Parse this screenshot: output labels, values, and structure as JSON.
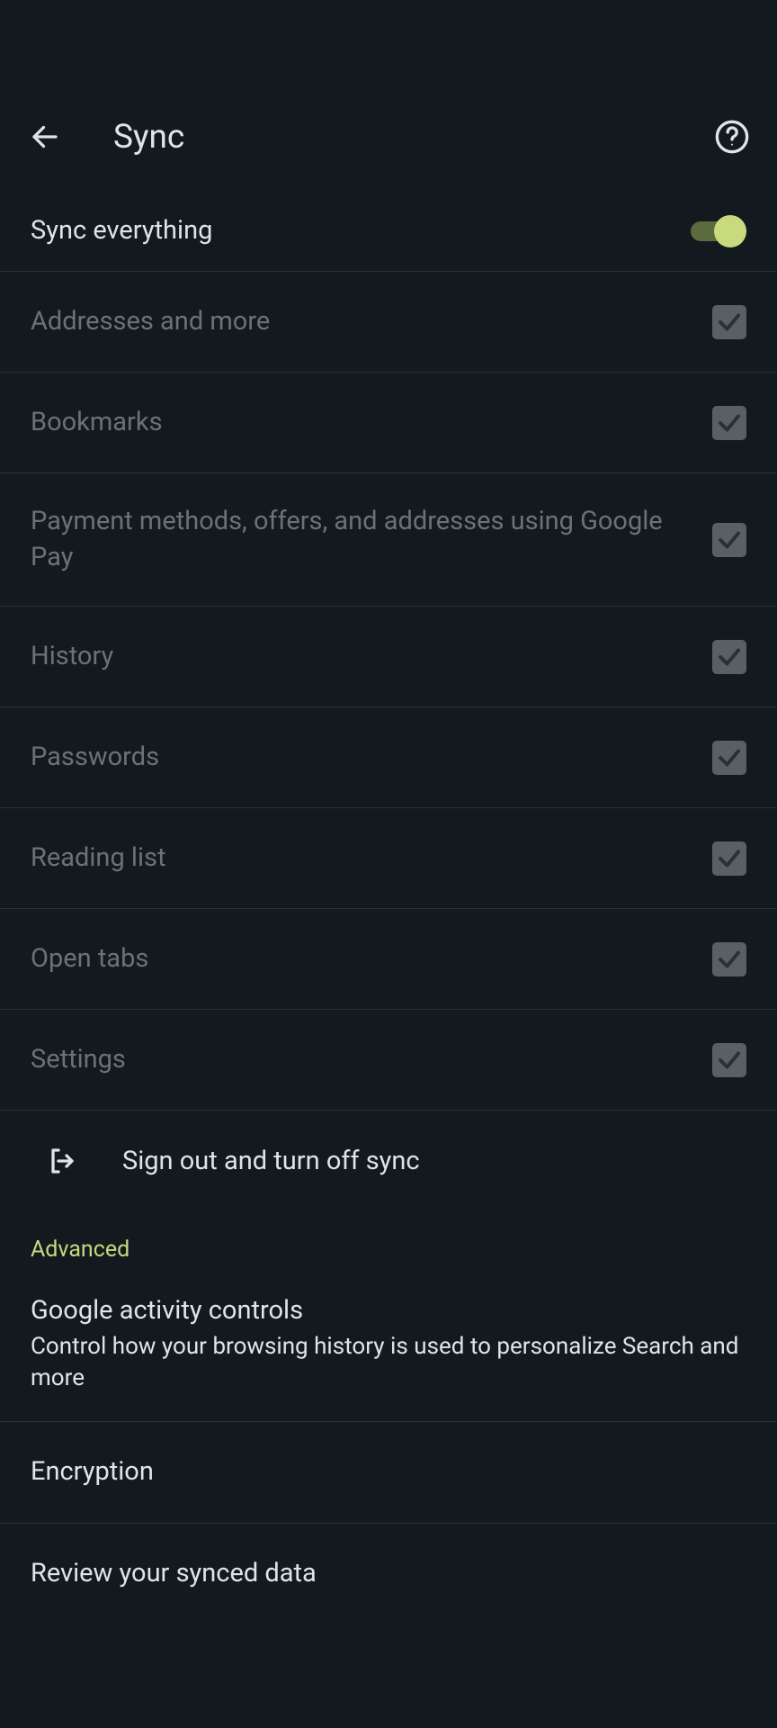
{
  "header": {
    "title": "Sync"
  },
  "sync_all": {
    "label": "Sync everything",
    "on": true
  },
  "items": [
    {
      "label": "Addresses and more"
    },
    {
      "label": "Bookmarks"
    },
    {
      "label": "Payment methods, offers, and addresses using Google Pay"
    },
    {
      "label": "History"
    },
    {
      "label": "Passwords"
    },
    {
      "label": "Reading list"
    },
    {
      "label": "Open tabs"
    },
    {
      "label": "Settings"
    }
  ],
  "sign_out": {
    "label": "Sign out and turn off sync"
  },
  "advanced": {
    "heading": "Advanced",
    "items": [
      {
        "title": "Google activity controls",
        "subtitle": "Control how your browsing history is used to personalize Search and more"
      },
      {
        "title": "Encryption"
      },
      {
        "title": "Review your synced data"
      }
    ]
  }
}
